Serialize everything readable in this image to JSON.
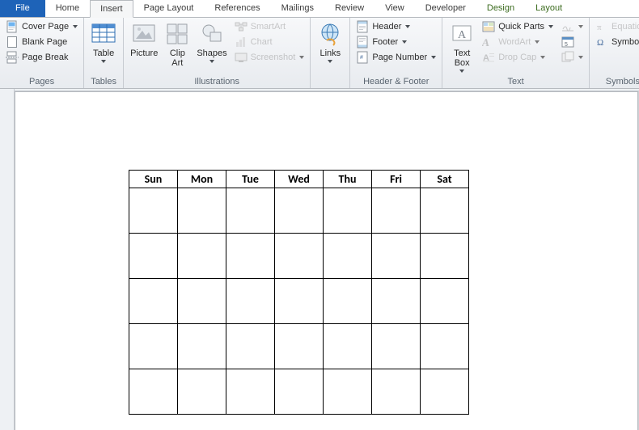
{
  "tabs": {
    "file": "File",
    "home": "Home",
    "insert": "Insert",
    "page_layout": "Page Layout",
    "references": "References",
    "mailings": "Mailings",
    "review": "Review",
    "view": "View",
    "developer": "Developer",
    "design": "Design",
    "layout": "Layout"
  },
  "ribbon": {
    "pages": {
      "label": "Pages",
      "cover_page": "Cover Page",
      "blank_page": "Blank Page",
      "page_break": "Page Break"
    },
    "tables": {
      "label": "Tables",
      "table": "Table"
    },
    "illustrations": {
      "label": "Illustrations",
      "picture": "Picture",
      "clip_art": "Clip\nArt",
      "shapes": "Shapes",
      "smartart": "SmartArt",
      "chart": "Chart",
      "screenshot": "Screenshot"
    },
    "links": {
      "label": "",
      "links": "Links"
    },
    "header_footer": {
      "label": "Header & Footer",
      "header": "Header",
      "footer": "Footer",
      "page_number": "Page Number"
    },
    "text": {
      "label": "Text",
      "text_box": "Text\nBox",
      "quick_parts": "Quick Parts",
      "wordart": "WordArt",
      "drop_cap": "Drop Cap"
    },
    "symbols": {
      "label": "Symbols",
      "equation": "Equation",
      "symbol": "Symbol"
    }
  },
  "calendar": {
    "headers": [
      "Sun",
      "Mon",
      "Tue",
      "Wed",
      "Thu",
      "Fri",
      "Sat"
    ],
    "rows": 5
  }
}
